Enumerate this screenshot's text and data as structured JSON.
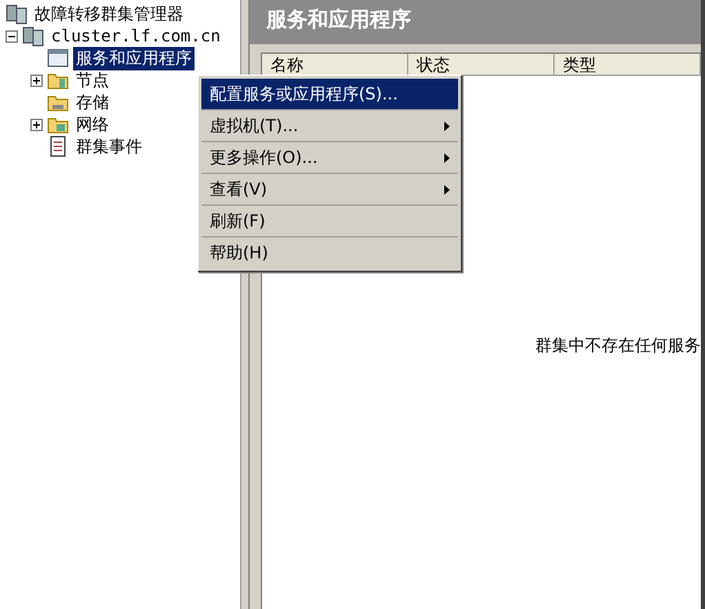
{
  "tree": {
    "label": "故障转移群集管理器",
    "children": [
      {
        "label": "cluster.lf.com.cn",
        "kind": "cluster",
        "expandable": true,
        "expanded": true,
        "selected": false,
        "children": [
          {
            "label": "服务和应用程序",
            "kind": "services",
            "expandable": false,
            "selected": true
          },
          {
            "label": "节点",
            "kind": "nodes",
            "expandable": true,
            "expanded": false,
            "selected": false
          },
          {
            "label": "存储",
            "kind": "storage",
            "expandable": false,
            "selected": false
          },
          {
            "label": "网络",
            "kind": "network",
            "expandable": true,
            "expanded": false,
            "selected": false
          },
          {
            "label": "群集事件",
            "kind": "events",
            "expandable": false,
            "selected": false
          }
        ]
      }
    ]
  },
  "context_menu": [
    {
      "label": "配置服务或应用程序(S)...",
      "selected": true,
      "submenu": false
    },
    {
      "label": "虚拟机(T)...",
      "selected": false,
      "submenu": true
    },
    {
      "label": "更多操作(O)...",
      "selected": false,
      "submenu": true
    },
    {
      "label": "查看(V)",
      "selected": false,
      "submenu": true
    },
    {
      "label": "刷新(F)",
      "selected": false,
      "submenu": false
    },
    {
      "label": "帮助(H)",
      "selected": false,
      "submenu": false
    }
  ],
  "panel": {
    "title": "服务和应用程序",
    "columns": [
      "名称",
      "状态",
      "类型"
    ],
    "empty_message": "群集中不存在任何服务"
  }
}
